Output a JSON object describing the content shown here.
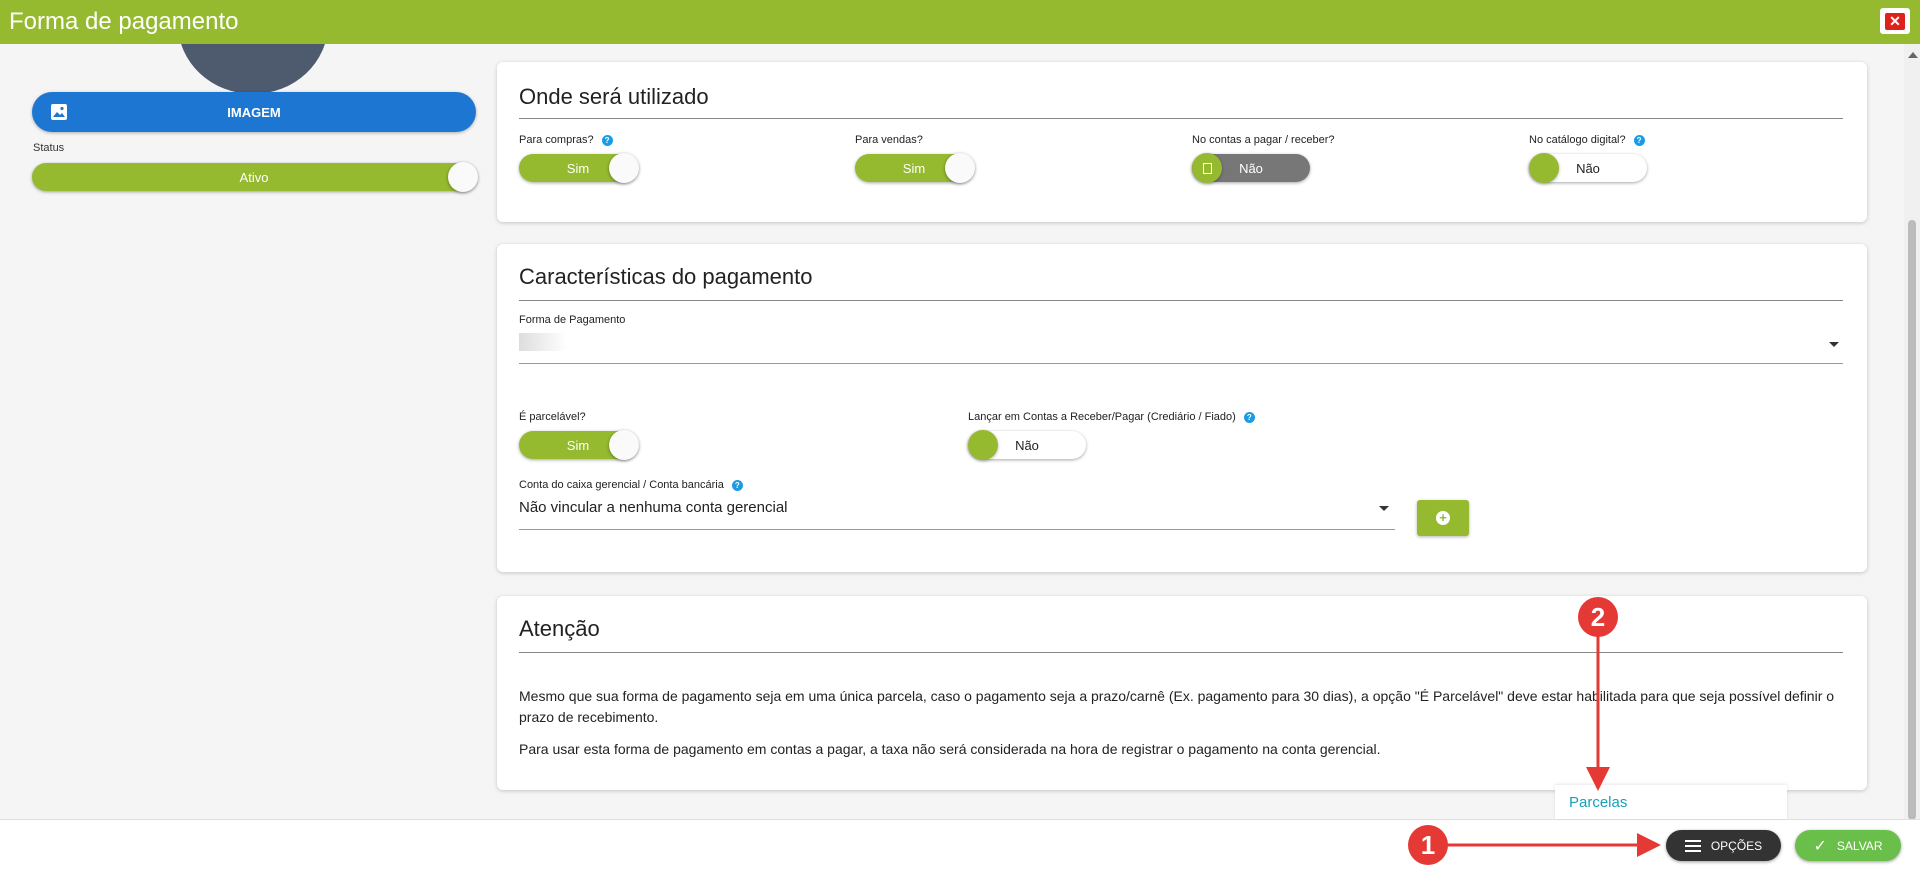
{
  "window": {
    "title": "Forma de pagamento",
    "close_icon": "close-icon"
  },
  "sidebar": {
    "image_button_label": "IMAGEM",
    "status_label": "Status",
    "status_value": "Ativo"
  },
  "usage": {
    "title": "Onde será utilizado",
    "fields": [
      {
        "label": "Para compras?",
        "value": "Sim",
        "state": "on",
        "help": true
      },
      {
        "label": "Para vendas?",
        "value": "Sim",
        "state": "on",
        "help": false
      },
      {
        "label": "No contas a pagar / receber?",
        "value": "Não",
        "state": "disabled",
        "help": false
      },
      {
        "label": "No catálogo digital?",
        "value": "Não",
        "state": "off",
        "help": true
      }
    ]
  },
  "characteristics": {
    "title": "Características do pagamento",
    "payment_form_label": "Forma de Pagamento",
    "installable_label": "É parcelável?",
    "installable_value": "Sim",
    "post_accounts_label": "Lançar em Contas a Receber/Pagar (Crediário / Fiado)",
    "post_accounts_value": "Não",
    "account_label": "Conta do caixa gerencial / Conta bancária",
    "account_value": "Não vincular a nenhuma conta gerencial"
  },
  "attention": {
    "title": "Atenção",
    "paragraph1": "Mesmo que sua forma de pagamento seja em uma única parcela, caso o pagamento seja a prazo/carnê (Ex. pagamento para 30 dias), a opção \"É Parcelável\" deve estar habilitada para que seja possível definir o prazo de recebimento.",
    "paragraph2": "Para usar esta forma de pagamento em contas a pagar, a taxa não será considerada na hora de registrar o pagamento na conta gerencial."
  },
  "footer": {
    "menu_item": "Parcelas",
    "options_label": "OPÇÕES",
    "save_label": "SALVAR"
  },
  "annotations": {
    "badge1": "1",
    "badge2": "2"
  },
  "colors": {
    "brand": "#95b92f",
    "primary": "#1d76d2",
    "annotation": "#e53935",
    "link": "#17a2b8"
  }
}
